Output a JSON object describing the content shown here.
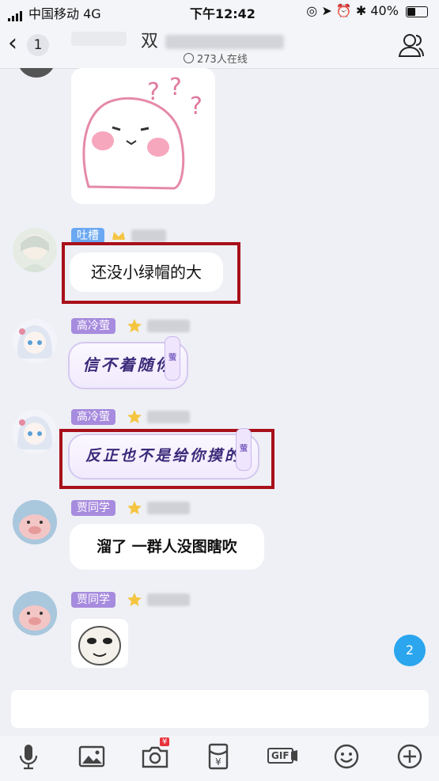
{
  "status_bar": {
    "carrier": "中国移动",
    "network": "4G",
    "time": "下午12:42",
    "battery": "40%",
    "battery_level": 0.4
  },
  "header": {
    "back_badge": "1",
    "title_prefix": "双",
    "online": "273人在线"
  },
  "messages": [
    {
      "tag": "",
      "text": ""
    },
    {
      "tag": "吐槽",
      "text": "还没小绿帽的大",
      "highlighted": true
    },
    {
      "tag": "高冷萤",
      "text": "信不着随你",
      "bubble_badge": "萤"
    },
    {
      "tag": "高冷萤",
      "text": "反正也不是给你摸的",
      "bubble_badge": "萤",
      "highlighted": true
    },
    {
      "tag": "贾同学",
      "text": "溜了 一群人没图瞎吹"
    },
    {
      "tag": "贾同学",
      "text": ""
    }
  ],
  "unread_count": "2",
  "toolbar": {
    "icons": [
      "microphone-icon",
      "image-icon",
      "camera-icon",
      "red-packet-icon",
      "gif-icon",
      "emoji-icon",
      "plus-icon"
    ],
    "camera_badge": "¥",
    "gif_label": "GIF"
  },
  "colors": {
    "tag_blue": "#6ba8f2",
    "tag_purple": "#a78bde",
    "highlight_red": "#a8101a",
    "unread_blue": "#2aa5ee"
  }
}
